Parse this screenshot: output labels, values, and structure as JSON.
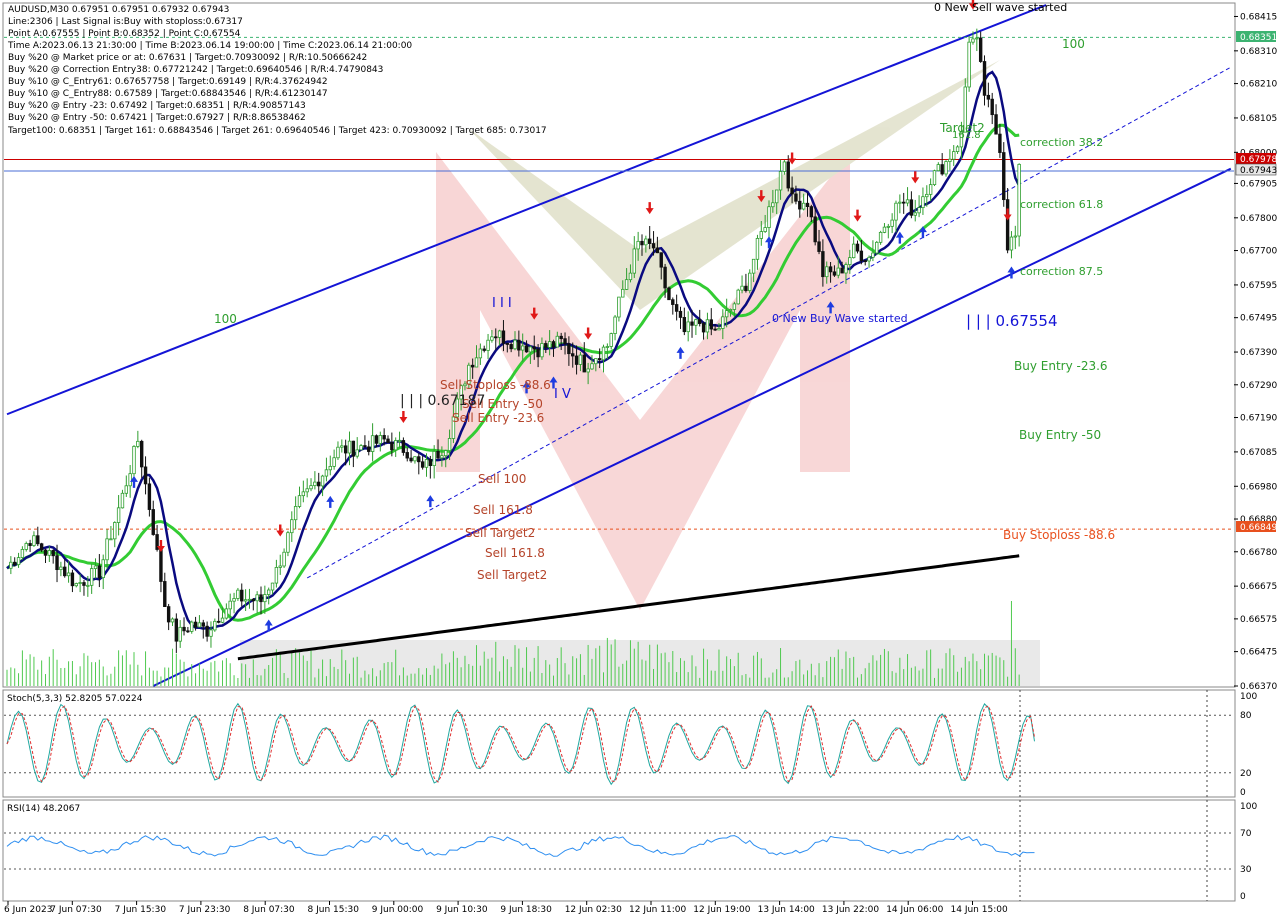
{
  "info_lines": [
    "AUDUSD,M30  0.67951 0.67951 0.67932 0.67943",
    "Line:2306 | Last Signal is:Buy with stoploss:0.67317",
    "Point A:0.67555 | Point B:0.68352 | Point C:0.67554",
    "Time A:2023.06.13 21:30:00 | Time B:2023.06.14 19:00:00 | Time C:2023.06.14 21:00:00",
    "Buy %20 @ Market price or at: 0.67631 | Target:0.70930092 | R/R:10.50666242",
    "Buy %20 @ Correction Entry38: 0.67721242 | Target:0.69640546 | R/R:4.74790843",
    "Buy %10 @ C_Entry61: 0.67657758 | Target:0.69149 | R/R:4.37624942",
    "Buy %10 @ C_Entry88: 0.67589 | Target:0.68843546 | R/R:4.61230147",
    "Buy %20 @ Entry -23: 0.67492 | Target:0.68351 | R/R:4.90857143",
    "Buy %20 @ Entry -50: 0.67421 | Target:0.67927 | R/R:8.86538462",
    "Target100: 0.68351 | Target 161: 0.68843546 | Target 261: 0.69640546 | Target 423: 0.70930092 | Target 685: 0.73017"
  ],
  "main_labels": {
    "new_sell_wave": "0 New Sell wave started",
    "new_buy_wave": "0 New Buy Wave started",
    "label_100_top": "100",
    "label_100_left": "100",
    "target2_top": "Target2",
    "label_1618": "161.8",
    "correction_382": "correction 38.2",
    "correction_618": "correction 61.8",
    "correction_875": "correction 87.5",
    "point_c_label": "| | | 0.67554",
    "buy_entry_236": "Buy Entry -23.6",
    "buy_entry_50": "Buy Entry -50",
    "buy_stoploss": "Buy Stoploss -88.6",
    "sell_stoploss": "Sell Stoploss -88.6",
    "sell_entry_50": "Sell Entry -50",
    "sell_entry_236": "Sell Entry -23.6",
    "sell_100": "Sell 100",
    "sell_1618": "Sell 161.8",
    "sell_target2": "Sell Target2",
    "sell_1618b": "Sell 161.8",
    "sell_target2b": "Sell Target2",
    "mid_value": "| | | 0.67187",
    "roman_iv": "I V",
    "roman_iii": "I I I"
  },
  "price_tags": {
    "top": "0.68351",
    "red": "0.67978",
    "blue": "0.67943",
    "orange": "0.66849"
  },
  "indicator_labels": {
    "stoch": "Stoch(5,3,3) 52.8205 57.0224",
    "rsi": "RSI(14) 48.2067"
  },
  "colors": {
    "bull_candle": "#2e9e2e",
    "bear_candle": "#111111",
    "channel": "#1414d6",
    "ma_fast": "#0a0a80",
    "ma_mid": "#33cc33",
    "ma_slow": "#000000",
    "red_line": "#cc0000",
    "orange_line": "#e8501e",
    "green_text": "#2e9e2e",
    "brown_text": "#b5442a",
    "stoch_main": "#20a8a0",
    "stoch_signal": "#e03030",
    "rsi_line": "#2f8ff0"
  },
  "chart_data": {
    "type": "candlestick",
    "symbol": "AUDUSD",
    "timeframe": "M30",
    "ylim": [
      0.6637,
      0.6845
    ],
    "y_ticks": [
      "0.68415",
      "0.68310",
      "0.68210",
      "0.68105",
      "0.68000",
      "0.67905",
      "0.67800",
      "0.67700",
      "0.67595",
      "0.67495",
      "0.67390",
      "0.67290",
      "0.67190",
      "0.67085",
      "0.66980",
      "0.66880",
      "0.66780",
      "0.66675",
      "0.66575",
      "0.66475",
      "0.66370"
    ],
    "x_ticks": [
      "6 Jun 2023",
      "7 Jun 07:30",
      "7 Jun 15:30",
      "7 Jun 23:30",
      "8 Jun 07:30",
      "8 Jun 15:30",
      "9 Jun 00:00",
      "9 Jun 10:30",
      "9 Jun 18:30",
      "12 Jun 02:30",
      "12 Jun 11:00",
      "12 Jun 19:00",
      "13 Jun 14:00",
      "13 Jun 22:00",
      "14 Jun 06:00",
      "14 Jun 15:00"
    ],
    "close_anchors": [
      [
        0,
        0.6673
      ],
      [
        6,
        0.6682
      ],
      [
        12,
        0.6676
      ],
      [
        18,
        0.6668
      ],
      [
        24,
        0.6672
      ],
      [
        30,
        0.6695
      ],
      [
        34,
        0.6712
      ],
      [
        38,
        0.6685
      ],
      [
        41,
        0.6662
      ],
      [
        44,
        0.6652
      ],
      [
        48,
        0.6656
      ],
      [
        52,
        0.6654
      ],
      [
        56,
        0.666
      ],
      [
        60,
        0.6664
      ],
      [
        66,
        0.6663
      ],
      [
        70,
        0.6672
      ],
      [
        76,
        0.6693
      ],
      [
        82,
        0.6702
      ],
      [
        86,
        0.6709
      ],
      [
        92,
        0.671
      ],
      [
        98,
        0.6712
      ],
      [
        104,
        0.6709
      ],
      [
        108,
        0.6703
      ],
      [
        114,
        0.6711
      ],
      [
        120,
        0.6735
      ],
      [
        126,
        0.6745
      ],
      [
        132,
        0.6742
      ],
      [
        138,
        0.674
      ],
      [
        144,
        0.6742
      ],
      [
        150,
        0.6735
      ],
      [
        156,
        0.6741
      ],
      [
        160,
        0.6758
      ],
      [
        164,
        0.6772
      ],
      [
        168,
        0.6771
      ],
      [
        172,
        0.6755
      ],
      [
        176,
        0.6745
      ],
      [
        180,
        0.6748
      ],
      [
        184,
        0.6745
      ],
      [
        188,
        0.6752
      ],
      [
        192,
        0.676
      ],
      [
        196,
        0.6775
      ],
      [
        200,
        0.679
      ],
      [
        202,
        0.6798
      ],
      [
        204,
        0.6785
      ],
      [
        208,
        0.6785
      ],
      [
        212,
        0.6763
      ],
      [
        216,
        0.6763
      ],
      [
        220,
        0.677
      ],
      [
        224,
        0.6768
      ],
      [
        228,
        0.6778
      ],
      [
        232,
        0.6785
      ],
      [
        236,
        0.6782
      ],
      [
        240,
        0.6792
      ],
      [
        244,
        0.6797
      ],
      [
        248,
        0.6805
      ],
      [
        250,
        0.6835
      ],
      [
        252,
        0.6833
      ],
      [
        254,
        0.6818
      ],
      [
        256,
        0.681
      ],
      [
        258,
        0.6802
      ],
      [
        260,
        0.6772
      ],
      [
        262,
        0.6774
      ],
      [
        263,
        0.6794
      ]
    ],
    "lines": {
      "target_100": 0.68351,
      "red_level": 0.67978,
      "blue_level": 0.67943,
      "buy_stoploss": 0.66849
    },
    "channel": {
      "upper": [
        [
          0,
          0.672
        ],
        [
          270,
          0.6845
        ]
      ],
      "lower": [
        [
          38,
          0.6637
        ],
        [
          318,
          0.6795
        ]
      ],
      "mid": [
        [
          78,
          0.667
        ],
        [
          318,
          0.6826
        ]
      ]
    },
    "volume_peak_index": 261,
    "stoch": {
      "levels": [
        100,
        80,
        20,
        0
      ],
      "k_last": 52.8205,
      "d_last": 57.0224
    },
    "rsi": {
      "levels": [
        100,
        70,
        30,
        0
      ],
      "last": 48.2067
    }
  }
}
